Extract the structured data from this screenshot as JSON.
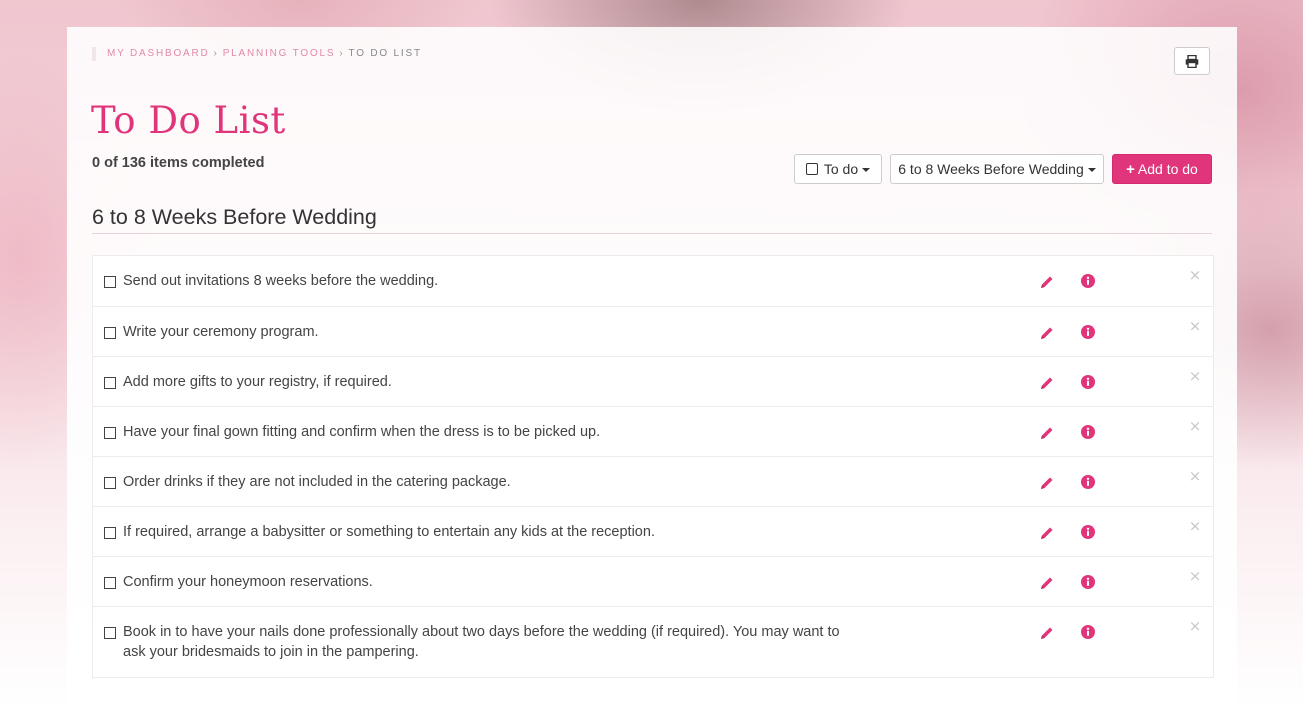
{
  "breadcrumb": {
    "items": [
      "MY DASHBOARD",
      "PLANNING TOOLS",
      "TO DO LIST"
    ],
    "separator": "›"
  },
  "header": {
    "title": "To Do List",
    "progress": "0 of 136 items completed",
    "print_icon": "print-icon"
  },
  "toolbar": {
    "status_filter_label": "To do",
    "timeframe_filter_label": "6 to 8 Weeks Before Wedding",
    "add_button_label": "Add to do"
  },
  "section": {
    "heading": "6 to 8 Weeks Before Wedding",
    "tasks": [
      {
        "text": "Send out invitations 8 weeks before the wedding.",
        "completed": false
      },
      {
        "text": "Write your ceremony program.",
        "completed": false
      },
      {
        "text": "Add more gifts to your registry, if required.",
        "completed": false
      },
      {
        "text": "Have your final gown fitting and confirm when the dress is to be picked up.",
        "completed": false
      },
      {
        "text": "Order drinks if they are not included in the catering package.",
        "completed": false
      },
      {
        "text": "If required, arrange a babysitter or something to entertain any kids at the reception.",
        "completed": false
      },
      {
        "text": "Confirm your honeymoon reservations.",
        "completed": false
      },
      {
        "text": "Book in to have your nails done professionally about two days before the wedding (if required). You may want to ask your bridesmaids to join in the pampering.",
        "completed": false
      }
    ],
    "remove_symbol": "×"
  },
  "colors": {
    "accent": "#e0357a",
    "breadcrumb_link": "#e28aa8",
    "text": "#444444"
  }
}
